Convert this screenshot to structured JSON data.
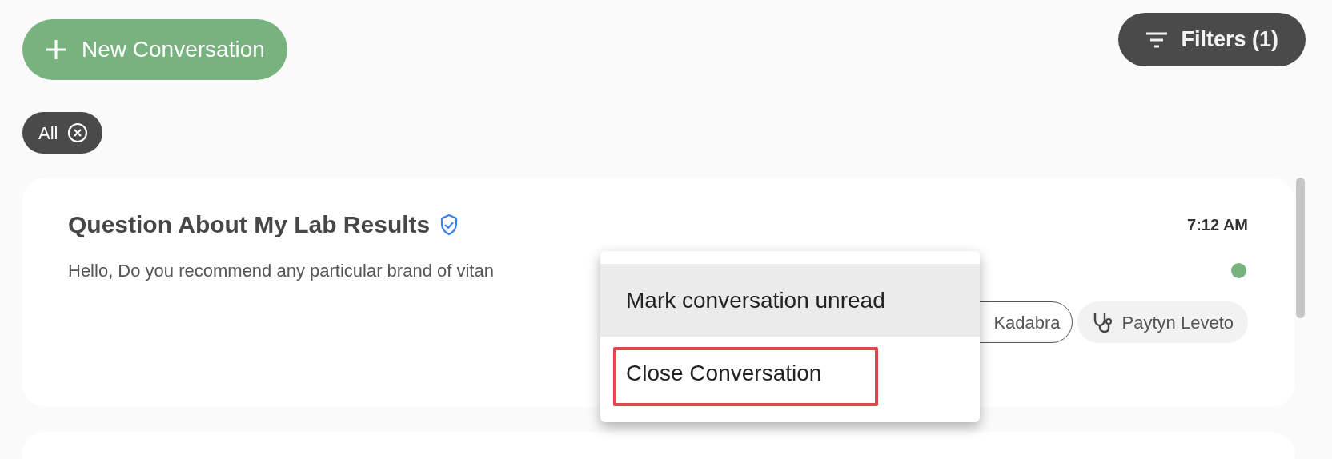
{
  "new_button": {
    "label": "New Conversation"
  },
  "filters_button": {
    "label": "Filters (1)"
  },
  "active_filters": [
    {
      "label": "All"
    }
  ],
  "conversations": [
    {
      "title": "Question About My Lab Results",
      "verified": true,
      "time": "7:12 AM",
      "preview": "Hello, Do you recommend any particular brand of vitan",
      "unread": true,
      "tags": [
        {
          "kind": "outline",
          "label": "Kadabra"
        },
        {
          "kind": "provider",
          "label": "Paytyn Leveto"
        }
      ]
    }
  ],
  "context_menu": {
    "items": [
      {
        "label": "Mark conversation unread",
        "highlighted": true,
        "outlined": false
      },
      {
        "label": "Close Conversation",
        "highlighted": false,
        "outlined": true
      }
    ]
  }
}
